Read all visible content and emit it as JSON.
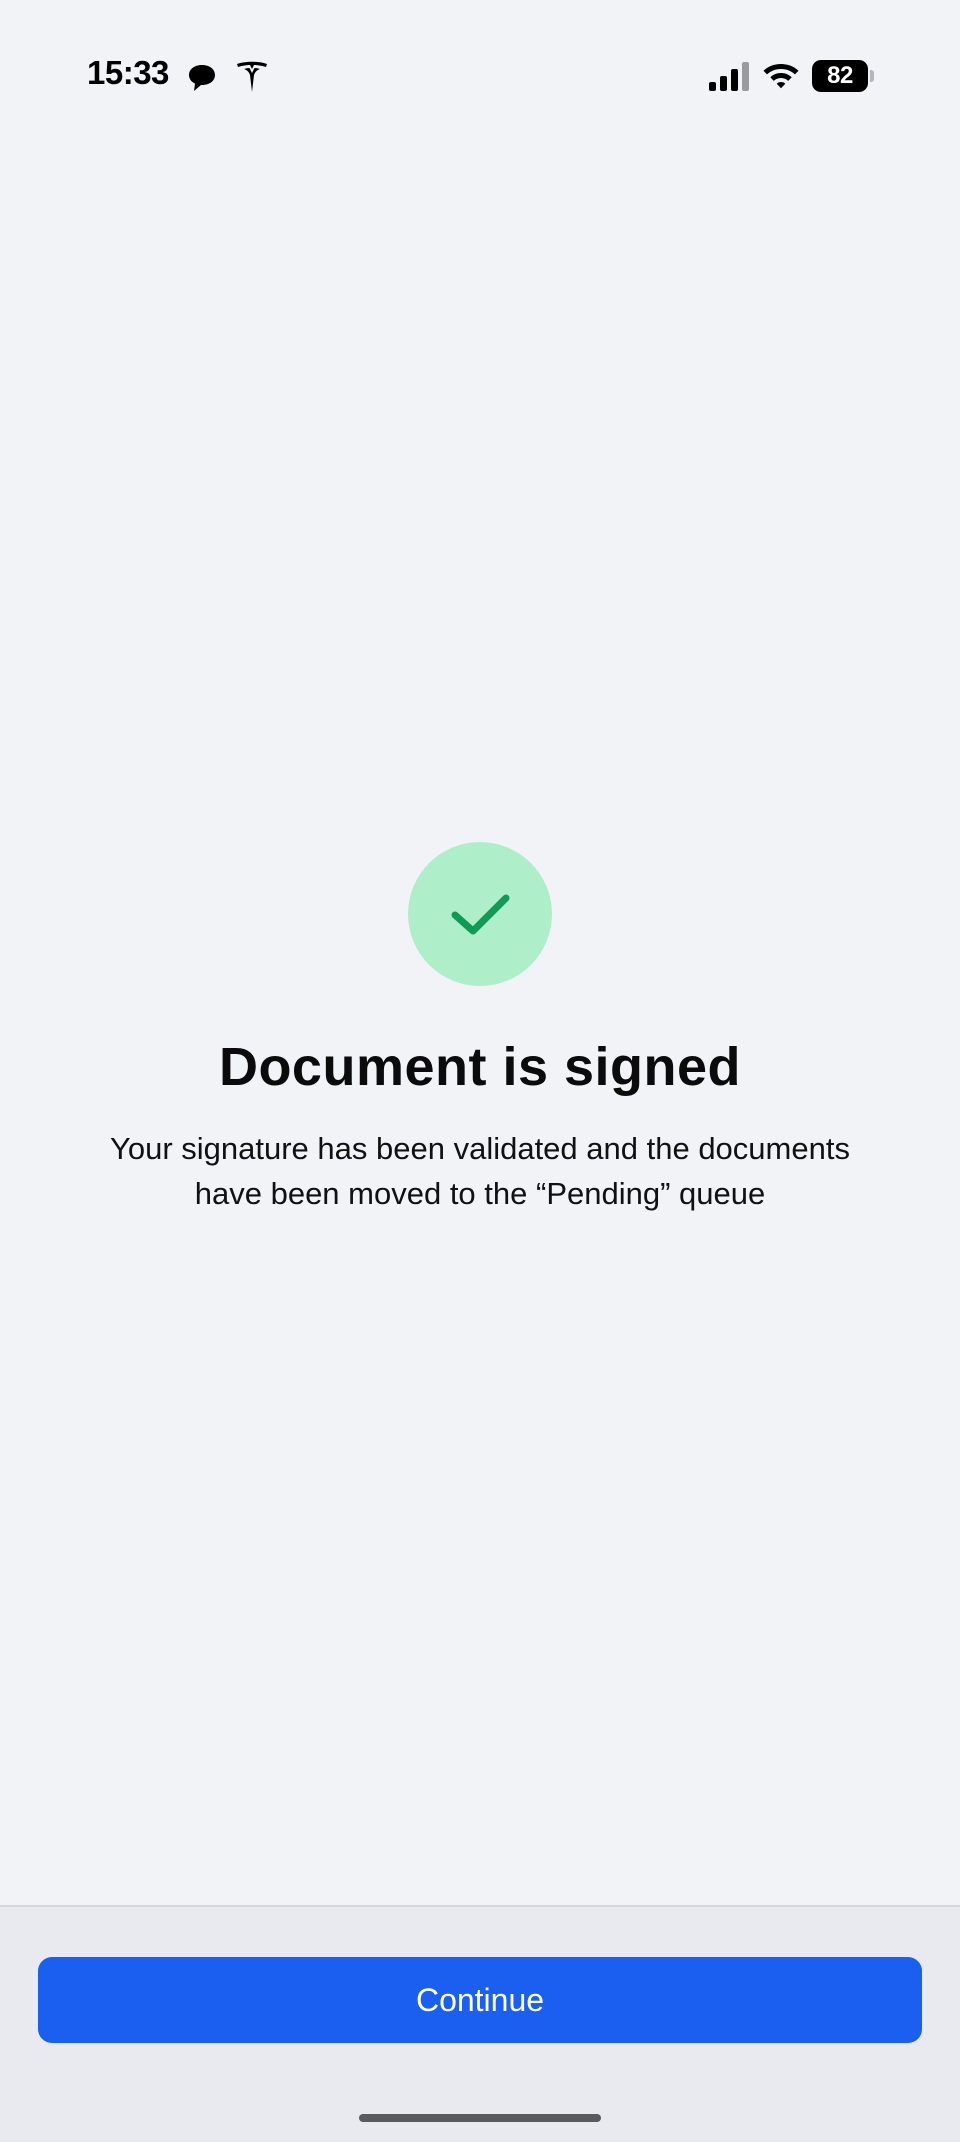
{
  "status_bar": {
    "time": "15:33",
    "battery_level": "82",
    "icons": [
      "chat-bubble-icon",
      "tesla-icon",
      "cellular-signal-icon",
      "wifi-icon",
      "battery-icon"
    ]
  },
  "success": {
    "icon": "checkmark-icon",
    "title": "Document is signed",
    "message": "Your signature has been validated and the documents have been moved to the “Pending” queue"
  },
  "footer": {
    "continue_label": "Continue"
  },
  "colors": {
    "background": "#f2f3f7",
    "accent": "#1a5ff0",
    "success_circle": "#aeeec8",
    "success_check": "#0f9a55",
    "footer_background": "#e9eaef"
  }
}
